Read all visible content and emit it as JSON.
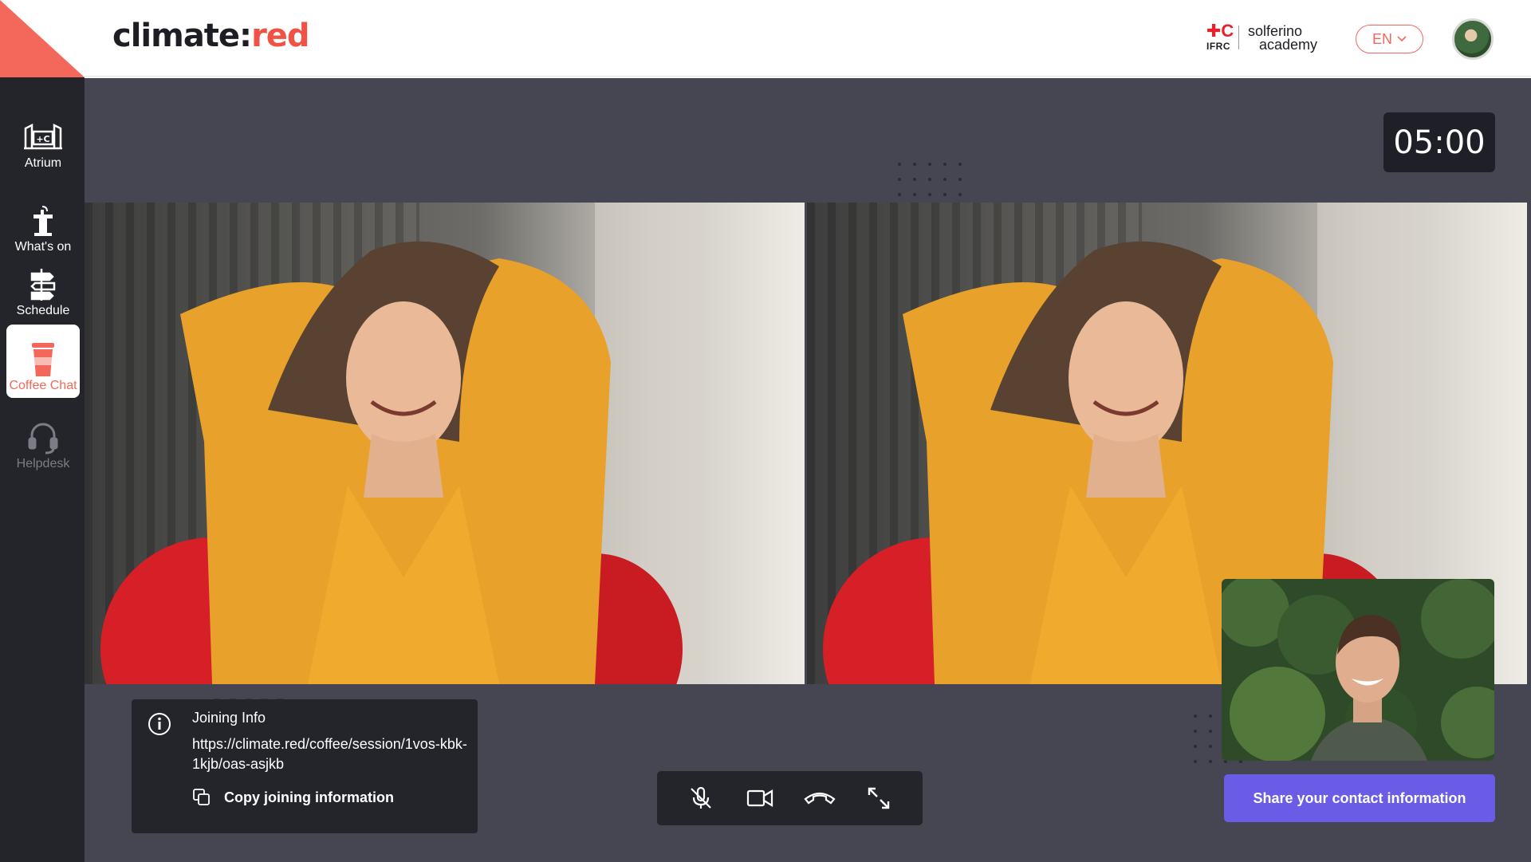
{
  "brand": {
    "logo_part1": "climate:",
    "logo_part2": "red",
    "accent": "#f4685b",
    "dark": "#24242b",
    "stage": "#464653",
    "button": "#6b5ce7"
  },
  "header": {
    "partner": {
      "mark": "✚C",
      "org": "IFRC",
      "line1": "solferino",
      "line2": "academy"
    },
    "language": {
      "selected": "EN",
      "icon": "chevron-down-icon"
    },
    "avatar": "user-avatar"
  },
  "sidebar": {
    "items": [
      {
        "label": "Atrium",
        "icon": "atrium-icon"
      },
      {
        "label": "What's on",
        "icon": "podium-icon"
      },
      {
        "label": "Schedule",
        "icon": "signpost-icon"
      },
      {
        "label": "Coffee Chat",
        "icon": "coffee-cup-icon",
        "active": true
      },
      {
        "label": "Helpdesk",
        "icon": "headset-icon",
        "disabled": true
      }
    ]
  },
  "timer": {
    "value": "05:00"
  },
  "participants": [
    {
      "tile": "remote-video-left"
    },
    {
      "tile": "remote-video-right"
    },
    {
      "tile": "self-view"
    }
  ],
  "joining_info": {
    "title": "Joining Info",
    "url": "https://climate.red/coffee/session/1vos-kbk-1kjb/oas-asjkb",
    "copy_label": "Copy joining information"
  },
  "controls": [
    {
      "icon": "mic-off-icon"
    },
    {
      "icon": "camera-icon"
    },
    {
      "icon": "hang-up-icon"
    },
    {
      "icon": "fullscreen-icon"
    }
  ],
  "share_button": {
    "label": "Share your contact information"
  }
}
